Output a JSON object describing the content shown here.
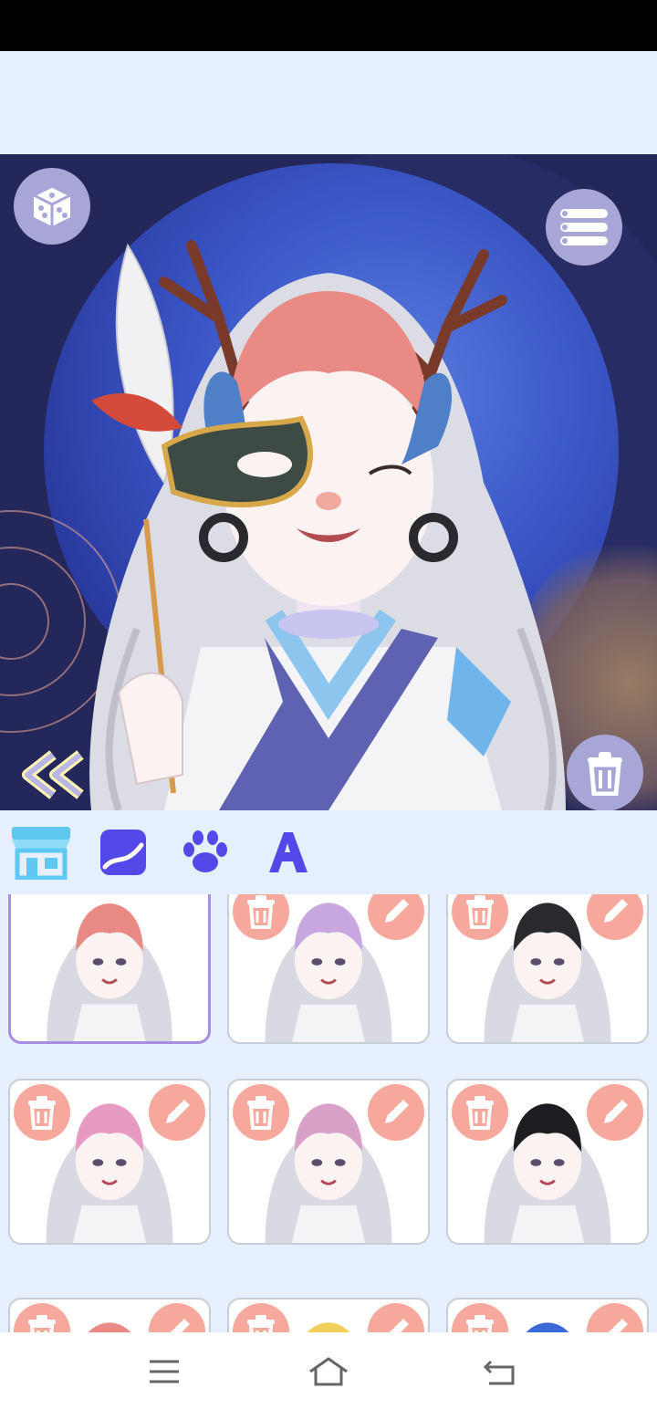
{
  "canvas": {
    "randomize_icon": "dice-icon",
    "menu_icon": "list-icon",
    "back_icon": "double-chevron-left-icon",
    "delete_icon": "trash-icon"
  },
  "tabs": [
    {
      "name": "shop",
      "icon": "shop-icon",
      "active": true
    },
    {
      "name": "background",
      "icon": "landscape-icon",
      "active": false
    },
    {
      "name": "pets",
      "icon": "paw-icon",
      "active": false
    },
    {
      "name": "text",
      "icon": "letter-a-icon",
      "active": false
    }
  ],
  "saved_characters": [
    {
      "id": "c1",
      "hair": "#e98a84",
      "selected": true
    },
    {
      "id": "c2",
      "hair": "#c8a7e0",
      "selected": false
    },
    {
      "id": "c3",
      "hair": "#2a2a2e",
      "selected": false
    },
    {
      "id": "c4",
      "hair": "#e79ac2",
      "selected": false
    },
    {
      "id": "c5",
      "hair": "#d8a2c8",
      "selected": false
    },
    {
      "id": "c6",
      "hair": "#1e1e22",
      "selected": false
    },
    {
      "id": "c7",
      "hair": "#e98a84",
      "selected": false
    },
    {
      "id": "c8",
      "hair": "#f2cf5a",
      "selected": false
    },
    {
      "id": "c9",
      "hair": "#3b6ad8",
      "selected": false
    }
  ],
  "colors": {
    "accent": "#5548e8",
    "card_action": "#f7a89c",
    "icon_button_bg": "#a7a6d6"
  },
  "nav": {
    "recents_icon": "menu-lines-icon",
    "home_icon": "home-icon",
    "back_icon": "back-arrow-icon"
  }
}
